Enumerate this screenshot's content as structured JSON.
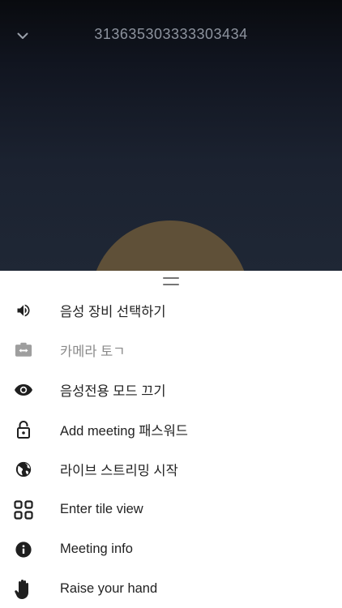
{
  "header": {
    "room_name": "313635303333303434",
    "collapse_icon": "chevron-down-icon"
  },
  "colors": {
    "header_bg_top": "#090b0f",
    "header_bg_bottom": "#1f2735",
    "avatar": "#5f5038",
    "icon": "#1f1f1f",
    "icon_disabled": "#9e9e9e",
    "text": "#222222",
    "text_disabled": "#8a8a8a"
  },
  "menu": {
    "items": [
      {
        "label": "음성 장비 선택하기",
        "icon": "volume-icon"
      },
      {
        "label": "카메라 토ㄱ",
        "icon": "camera-switch-icon",
        "disabled": true
      },
      {
        "label": "음성전용 모드 끄기",
        "icon": "eye-icon"
      },
      {
        "label": "Add meeting 패스워드",
        "icon": "lock-open-icon"
      },
      {
        "label": "라이브 스트리밍 시작",
        "icon": "globe-icon"
      },
      {
        "label": "Enter tile view",
        "icon": "tile-grid-icon"
      },
      {
        "label": "Meeting info",
        "icon": "info-icon"
      },
      {
        "label": "Raise your hand",
        "icon": "hand-icon"
      }
    ]
  }
}
